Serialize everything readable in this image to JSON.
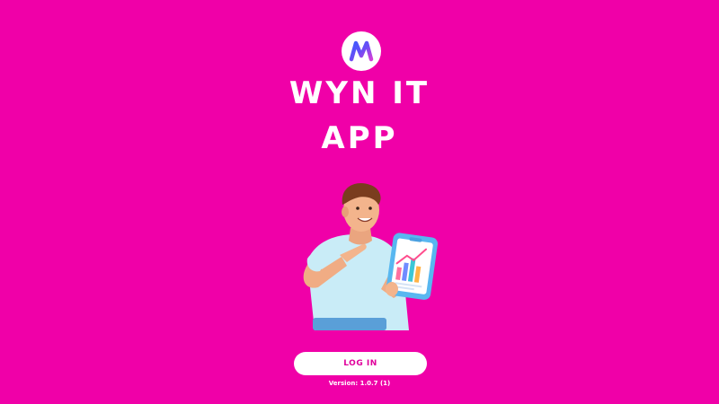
{
  "app": {
    "title_line1": "WYN IT",
    "title_line2": "APP",
    "logo_icon": "wyn-it-logo-icon",
    "illustration": "man-with-chart-tablet-illustration"
  },
  "login": {
    "label": "LOG IN"
  },
  "footer": {
    "version": "Version: 1.0.7 (1)"
  },
  "colors": {
    "background": "#f000a8",
    "button_bg": "#ffffff",
    "button_text": "#e0009b"
  }
}
